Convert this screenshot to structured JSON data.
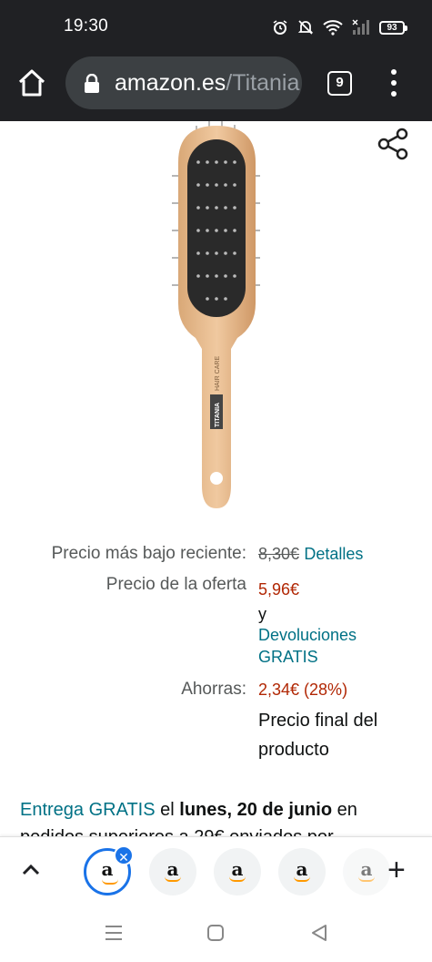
{
  "status": {
    "time": "19:30",
    "battery": "93"
  },
  "browser": {
    "domain": "amazon.es",
    "path": "/Titania",
    "tab_count": "9"
  },
  "product": {
    "image_brand": "TITANIA",
    "image_text": "HAIR CARE"
  },
  "pricing": {
    "recent_low_label": "Precio más bajo reciente:",
    "recent_low_value": "8,30€",
    "details_link": "Detalles",
    "deal_label": "Precio de la oferta",
    "deal_value": "5,96€",
    "and_text": "y",
    "returns_line1": "Devoluciones",
    "returns_line2": "GRATIS",
    "savings_label": "Ahorras:",
    "savings_value": "2,34€ (28%)",
    "final_line1": "Precio final del",
    "final_line2": "producto"
  },
  "delivery": {
    "free_link": "Entrega GRATIS",
    "text_el": " el ",
    "date": "lunes, 20 de junio",
    "text_en": " en",
    "next_line": "pedidos superiores a 29€ enviados por"
  },
  "tabstrip": {
    "tabs": [
      "a",
      "a",
      "a",
      "a",
      "a"
    ]
  },
  "colors": {
    "link": "#007185",
    "price": "#b12704",
    "chrome": "#202124",
    "active_tab": "#1a73e8"
  }
}
